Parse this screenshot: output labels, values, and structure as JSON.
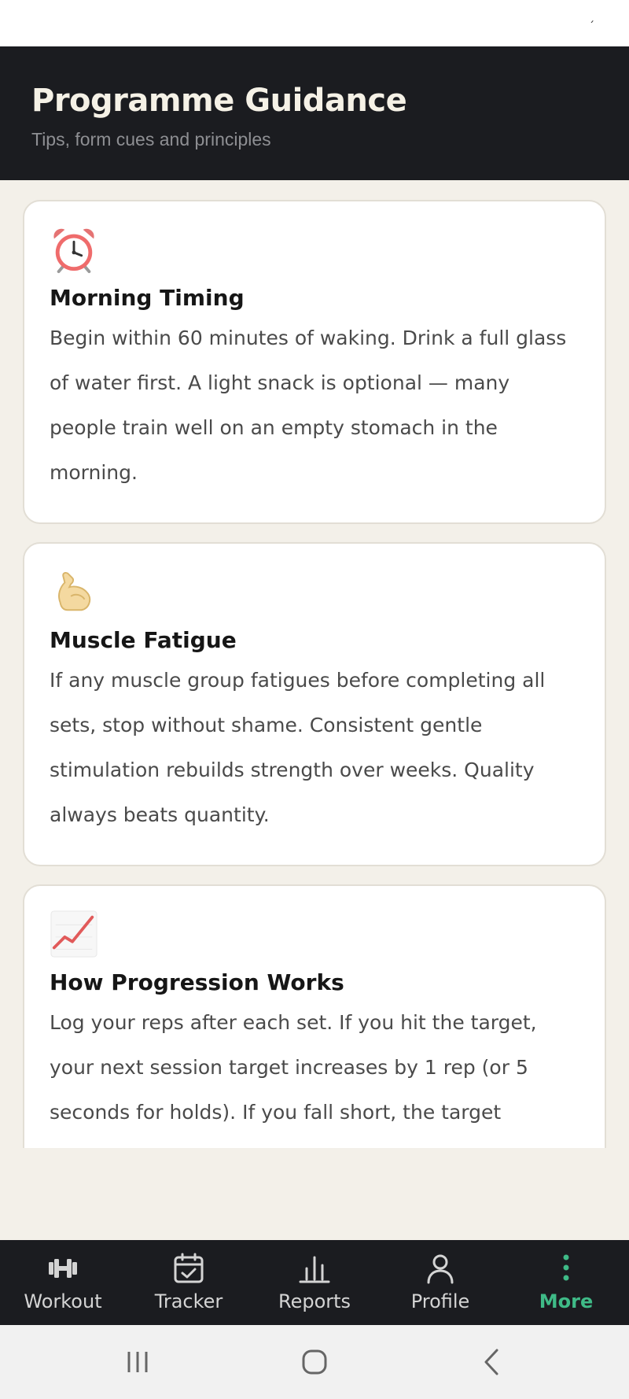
{
  "status_bar": {
    "indicator": "´"
  },
  "header": {
    "title": "Programme Guidance",
    "subtitle": "Tips, form cues and principles"
  },
  "cards": [
    {
      "icon": "alarm-clock-icon",
      "title": "Morning Timing",
      "text": "Begin within 60 minutes of waking. Drink a full glass of water first. A light snack is optional — many people train well on an empty stomach in the morning."
    },
    {
      "icon": "flexed-biceps-icon",
      "title": "Muscle Fatigue",
      "text": "If any muscle group fatigues before completing all sets, stop without shame. Consistent gentle stimulation rebuilds strength over weeks. Quality always beats quantity."
    },
    {
      "icon": "chart-increasing-icon",
      "title": "How Progression Works",
      "text": "Log your reps after each set. If you hit the target, your next session target increases by 1 rep (or 5 seconds for holds). If you fall short, the target"
    }
  ],
  "nav": {
    "items": [
      {
        "label": "Workout",
        "icon": "dumbbell-icon",
        "active": false
      },
      {
        "label": "Tracker",
        "icon": "calendar-check-icon",
        "active": false
      },
      {
        "label": "Reports",
        "icon": "bar-chart-icon",
        "active": false
      },
      {
        "label": "Profile",
        "icon": "person-icon",
        "active": false
      },
      {
        "label": "More",
        "icon": "more-vertical-icon",
        "active": true
      }
    ]
  },
  "colors": {
    "header_bg": "#1b1c20",
    "page_bg": "#f3f0e9",
    "accent": "#3fba87"
  }
}
